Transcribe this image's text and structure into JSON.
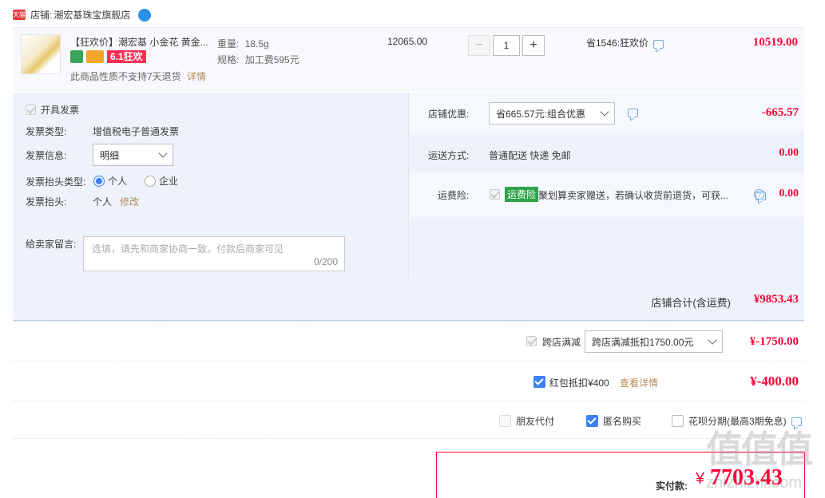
{
  "shop": {
    "badge": "天猫",
    "label": "店铺:",
    "name": "潮宏基珠宝旗舰店"
  },
  "item": {
    "title": "【狂欢价】潮宏基 小金花 黄金...",
    "promo_tag": "6.1狂欢",
    "weight_label": "重量:",
    "weight": "18.5g",
    "spec_label": "规格:",
    "spec": "加工费595元",
    "return_note": "此商品性质不支持7天退货",
    "detail_link": "详情",
    "unit_price": "12065.00",
    "quantity": "1",
    "minus": "−",
    "plus": "+",
    "discount_text": "省1546:狂欢价",
    "subtotal": "10519.00"
  },
  "invoice": {
    "open_label": "开具发票",
    "type_label": "发票类型:",
    "type_value": "增值税电子普通发票",
    "info_label": "发票信息:",
    "info_select": "明细",
    "header_type_label": "发票抬头类型:",
    "header_type_personal": "个人",
    "header_type_company": "企业",
    "header_label": "发票抬头:",
    "header_value": "个人",
    "header_edit": "修改"
  },
  "message": {
    "label": "给卖家留言:",
    "placeholder": "选填，请先和商家协商一致，付款后商家可见",
    "counter": "0/200"
  },
  "store_discount": {
    "label": "店铺优惠:",
    "select": "省665.57元:组合优惠",
    "amount": "-665.57"
  },
  "shipping": {
    "label": "运送方式:",
    "value": "普通配送 快递 免邮",
    "amount": "0.00"
  },
  "insurance": {
    "label": "运费险:",
    "tag": "运费险",
    "desc": "聚划算卖家赠送，若确认收货前退货，可获...",
    "amount": "0.00"
  },
  "store_total": {
    "label": "店铺合计(含运费)",
    "amount": "¥9853.43"
  },
  "cross_store": {
    "label": "跨店满减",
    "select": "跨店满减抵扣1750.00元",
    "amount": "¥-1750.00"
  },
  "red_packet": {
    "label": "红包抵扣¥400",
    "link": "查看详情",
    "amount": "¥-400.00"
  },
  "pay_options": {
    "friend": "朋友代付",
    "anonymous": "匿名购买",
    "huabei": "花呗分期(最高3期免息)"
  },
  "actual": {
    "label": "实付款:",
    "currency": "¥",
    "amount": "7703.43"
  },
  "watermark": {
    "big": "值值值",
    "small": "zhizhizhi.com"
  },
  "colors": {
    "accent_red": "#ff0036",
    "panel_bg": "#eef3fb",
    "check_blue": "#3b82f6"
  }
}
